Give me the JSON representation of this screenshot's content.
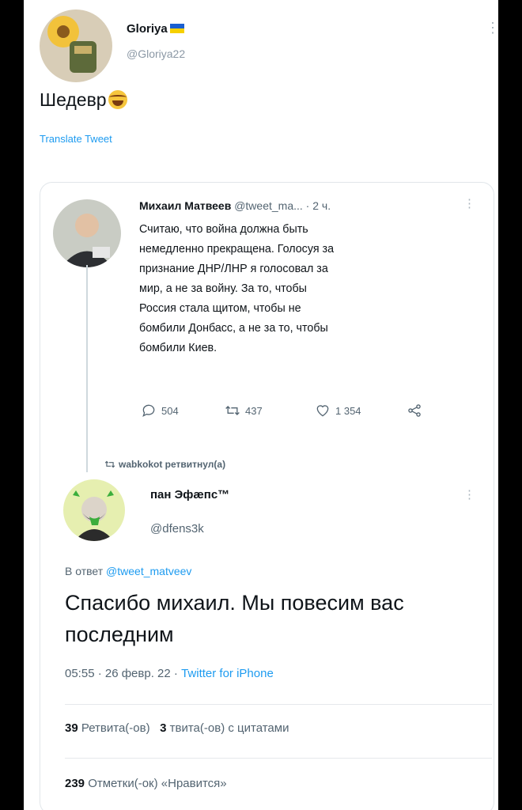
{
  "top_tweet": {
    "name": "Gloriya",
    "handle": "@Gloriya22",
    "text": "Шедевр",
    "translate_label": "Translate Tweet"
  },
  "quoted_tweet": {
    "name": "Михаил Матвеев",
    "handle": "@tweet_ma...",
    "time": "· 2 ч.",
    "text": "Считаю, что война должна быть\nнемедленно прекращена. Голосуя за\nпризнание ДНР/ЛНР я голосовал за\nмир, а не за войну. За то, чтобы\nРоссия стала щитом, чтобы не\nбомбили Донбасс, а не за то, чтобы\nбомбили Киев.",
    "replies": "504",
    "retweets": "437",
    "likes": "1 354"
  },
  "retweet_notice": "wabkokot ретвитнул(а)",
  "main_tweet": {
    "name": "пан Эфæпс™",
    "handle": "@dfens3k",
    "reply_prefix": "В ответ",
    "reply_handle": "@tweet_matveev",
    "text": "Спасибо михаил. Мы повесим вас последним",
    "timestamp": "05:55 · 26 февр. 22 ·",
    "source": "Twitter for iPhone",
    "retweets_count": "39",
    "retweets_label": "Ретвита(-ов)",
    "quotes_count": "3",
    "quotes_label": "твита(-ов) с цитатами",
    "likes_count": "239",
    "likes_label": "Отметки(-ок) «Нравится»"
  },
  "icons": {
    "more": "more-vertical-icon",
    "reply": "reply-icon",
    "retweet": "retweet-icon",
    "like": "heart-icon",
    "share": "share-icon"
  },
  "colors": {
    "link": "#1d9bf0",
    "secondary_text": "#536471",
    "flag_blue": "#1a5fd0",
    "flag_yellow": "#f6d000"
  }
}
